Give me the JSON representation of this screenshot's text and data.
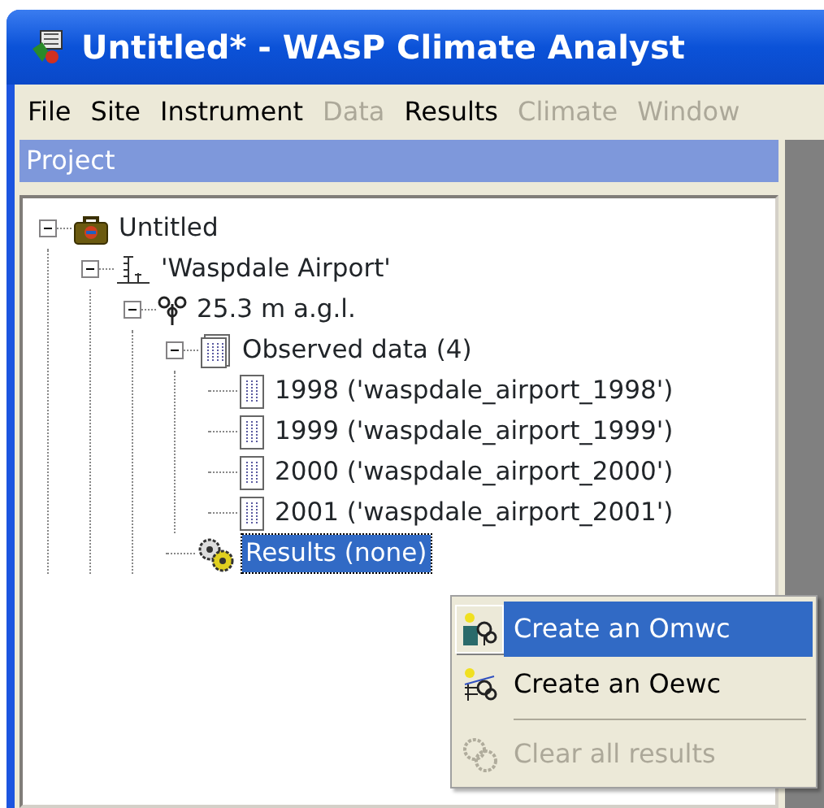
{
  "window": {
    "title": "Untitled* - WAsP Climate Analyst"
  },
  "menu_bar": [
    {
      "label": "File",
      "enabled": true
    },
    {
      "label": "Site",
      "enabled": true
    },
    {
      "label": "Instrument",
      "enabled": true
    },
    {
      "label": "Data",
      "enabled": false
    },
    {
      "label": "Results",
      "enabled": true
    },
    {
      "label": "Climate",
      "enabled": false
    },
    {
      "label": "Window",
      "enabled": false
    }
  ],
  "project_panel": {
    "title": "Project",
    "tree": [
      {
        "kind": "project",
        "label": "Untitled",
        "expanded": true,
        "selected": false,
        "children": [
          {
            "kind": "site",
            "label": "'Waspdale Airport'",
            "expanded": true,
            "selected": false,
            "children": [
              {
                "kind": "mast",
                "label": "25.3 m a.g.l.",
                "expanded": true,
                "selected": false,
                "children": [
                  {
                    "kind": "data-folder",
                    "label": "Observed data (4)",
                    "expanded": true,
                    "selected": false,
                    "children": [
                      {
                        "kind": "data-file",
                        "label": "1998 ('waspdale_airport_1998')",
                        "selected": false
                      },
                      {
                        "kind": "data-file",
                        "label": "1999 ('waspdale_airport_1999')",
                        "selected": false
                      },
                      {
                        "kind": "data-file",
                        "label": "2000 ('waspdale_airport_2000')",
                        "selected": false
                      },
                      {
                        "kind": "data-file",
                        "label": "2001 ('waspdale_airport_2001')",
                        "selected": false
                      }
                    ]
                  },
                  {
                    "kind": "results",
                    "label": "Results (none)",
                    "selected": true
                  }
                ]
              }
            ]
          }
        ]
      }
    ]
  },
  "context_menu": [
    {
      "kind": "item",
      "label": "Create an Omwc",
      "enabled": true,
      "selected": true
    },
    {
      "kind": "item",
      "label": "Create an Oewc",
      "enabled": true,
      "selected": false
    },
    {
      "kind": "separator"
    },
    {
      "kind": "item",
      "label": "Clear all results",
      "enabled": false,
      "selected": false
    }
  ]
}
